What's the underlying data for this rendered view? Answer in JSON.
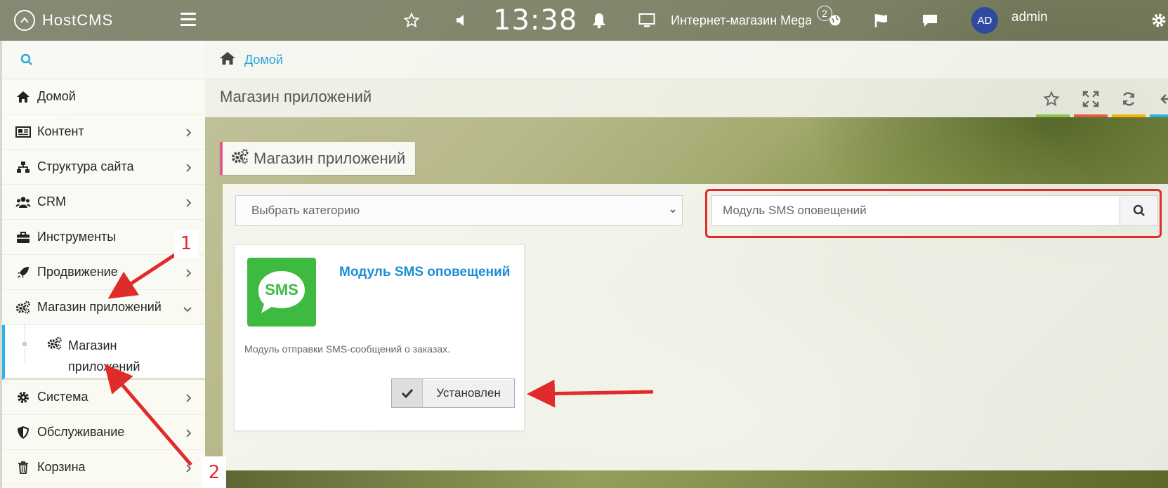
{
  "navbar": {
    "brand": "HostCMS",
    "clock": "13:38",
    "site_name": "Интернет-магазин Mega",
    "notifications_count": "2",
    "avatar_initials": "AD",
    "user": "admin"
  },
  "sidebar": {
    "items": [
      {
        "label": "Домой"
      },
      {
        "label": "Контент"
      },
      {
        "label": "Структура сайта"
      },
      {
        "label": "CRM"
      },
      {
        "label": "Инструменты"
      },
      {
        "label": "Продвижение"
      },
      {
        "label": "Магазин приложений"
      },
      {
        "label": "Система"
      },
      {
        "label": "Обслуживание"
      },
      {
        "label": "Корзина"
      }
    ],
    "sub_item": "Магазин приложений"
  },
  "breadcrumb": {
    "home": "Домой"
  },
  "page": {
    "title": "Магазин приложений"
  },
  "widget": {
    "tab_label": "Магазин приложений",
    "category_select": "Выбрать категорию",
    "search_value": "Модуль SMS оповещений"
  },
  "app": {
    "logo_text": "SMS",
    "title": "Модуль SMS оповещений",
    "description": "Модуль отправки SMS-сообщений о заказах.",
    "status_button": "Установлен"
  },
  "annotations": {
    "step1": "1",
    "step2": "2"
  },
  "colors": {
    "accent_blue": "#25b3e8",
    "link_blue": "#1a8fd4",
    "sms_green": "#3dba3f",
    "annotation_red": "#e02b2b",
    "tab_pink": "#e2588a"
  }
}
